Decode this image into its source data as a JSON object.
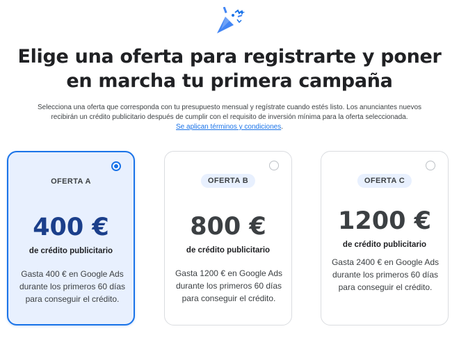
{
  "heading": {
    "line1": "Elige una oferta para registrarte y poner",
    "line2": "en marcha tu primera campaña"
  },
  "description": {
    "line1": "Selecciona una oferta que corresponda con tu presupuesto mensual y regístrate cuando estés listo. Los anunciantes nuevos",
    "line2": "recibirán un crédito publicitario después de cumplir con el requisito de inversión mínima para la oferta seleccionada.",
    "terms_link": "Se aplican términos y condiciones",
    "terms_suffix": "."
  },
  "offers": [
    {
      "label": "OFERTA A",
      "amount": "400 €",
      "subtitle": "de crédito publicitario",
      "text": "Gasta 400 € en Google Ads durante los primeros 60 días para conseguir el crédito.",
      "selected": true
    },
    {
      "label": "OFERTA B",
      "amount": "800 €",
      "subtitle": "de crédito publicitario",
      "text": "Gasta 1200 € en Google Ads durante los primeros 60 días para conseguir el crédito.",
      "selected": false
    },
    {
      "label": "OFERTA C",
      "amount": "1200 €",
      "subtitle": "de crédito publicitario",
      "text": "Gasta 2400 € en Google Ads durante los primeros 60 días para conseguir el crédito.",
      "selected": false
    }
  ],
  "colors": {
    "accent": "#1a73e8",
    "selected_bg": "#e8f0fe",
    "amount_selected": "#1b3f8b"
  },
  "icons": {
    "header": "party-popper-icon",
    "selected_radio": "radio-checked-icon",
    "unselected_radio": "radio-unchecked-icon"
  }
}
